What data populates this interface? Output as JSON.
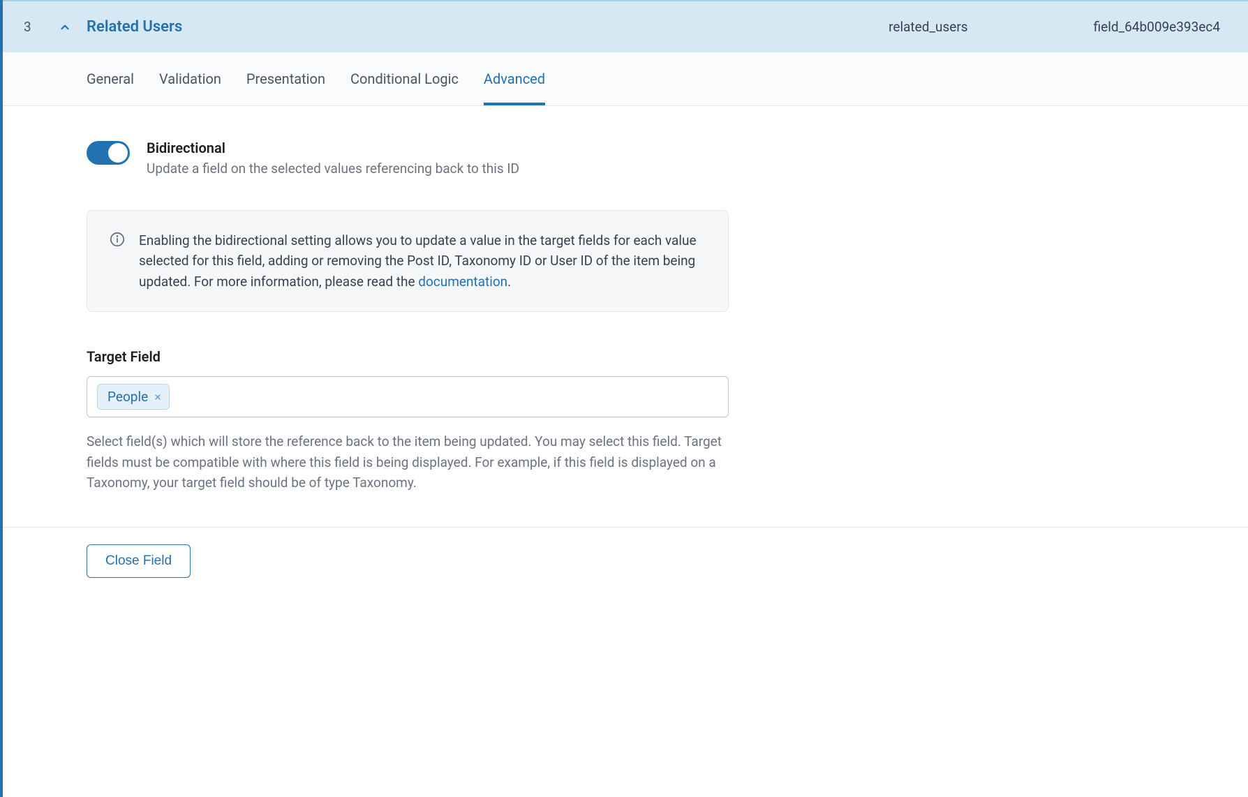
{
  "header": {
    "order": "3",
    "title": "Related Users",
    "slug": "related_users",
    "key": "field_64b009e393ec4"
  },
  "tabs": [
    {
      "label": "General"
    },
    {
      "label": "Validation"
    },
    {
      "label": "Presentation"
    },
    {
      "label": "Conditional Logic"
    },
    {
      "label": "Advanced"
    }
  ],
  "bidirectional": {
    "label": "Bidirectional",
    "description": "Update a field on the selected values referencing back to this ID",
    "infoPrefix": "Enabling the bidirectional setting allows you to update a value in the target fields for each value selected for this field, adding or removing the Post ID, Taxonomy ID or User ID of the item being updated. For more information, please read the ",
    "linkText": "documentation",
    "period": "."
  },
  "targetField": {
    "label": "Target Field",
    "chip": "People",
    "help": "Select field(s) which will store the reference back to the item being updated. You may select this field. Target fields must be compatible with where this field is being displayed. For example, if this field is displayed on a Taxonomy, your target field should be of type Taxonomy."
  },
  "buttons": {
    "close": "Close Field"
  }
}
